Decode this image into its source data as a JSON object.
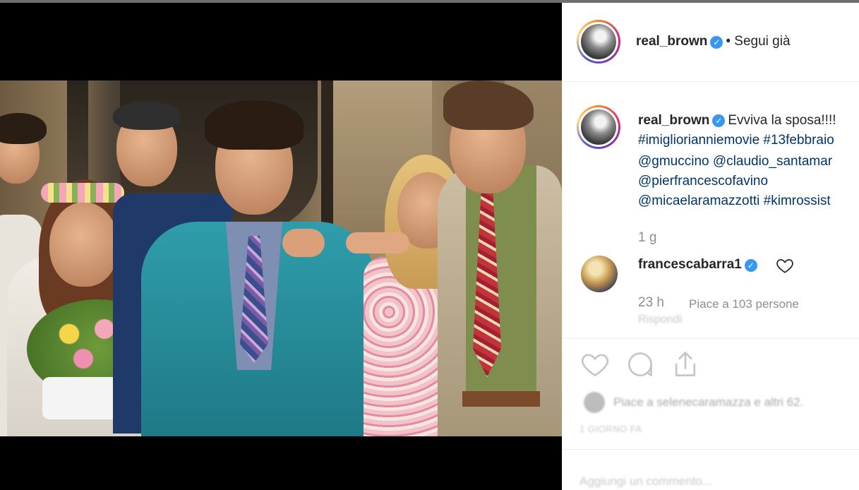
{
  "post": {
    "author": {
      "username": "real_brown",
      "verified": true,
      "follow_status": "• Segui già"
    },
    "caption": {
      "username": "real_brown",
      "text": "Evviva la sposa!!!!",
      "lines": [
        "#imigliorianniemovie #13febbraio",
        "@gmuccino @claudio_santamar",
        "@pierfrancescofavino",
        "@micaelaramazzotti #kimrossist"
      ],
      "time": "1 g"
    },
    "comment": {
      "username": "francescabarra1",
      "verified": true,
      "time": "23 h",
      "likes": "Piace a 103 persone",
      "reply_label": "Rispondi"
    },
    "actions": {
      "like_icon": "heart-outline-icon",
      "comment_icon": "comment-bubble-icon",
      "share_icon": "share-upload-icon"
    },
    "liked_by": "Piace a selenecaramazza e altri 62.",
    "post_date": "1 GIORNO FA",
    "add_comment_placeholder": "Aggiungi un commento..."
  },
  "colors": {
    "link": "#003569",
    "verified": "#3897f0",
    "muted": "#8e8e8e"
  }
}
